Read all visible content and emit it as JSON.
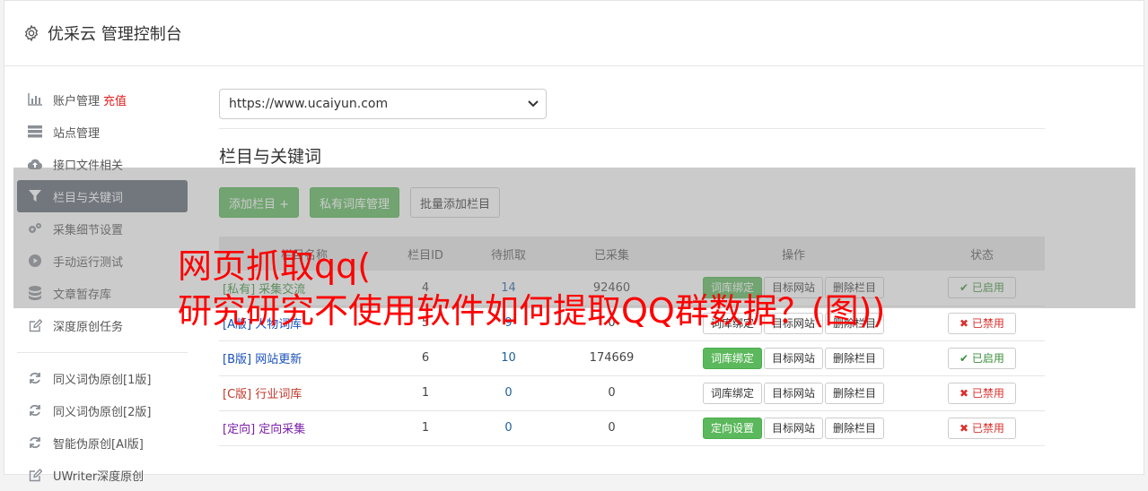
{
  "header": {
    "title": "优采云 管理控制台",
    "icon": "gear-icon"
  },
  "sidebar": {
    "items": [
      {
        "label": "账户管理",
        "badge": "充值",
        "icon": "bar-chart-icon"
      },
      {
        "label": "站点管理",
        "icon": "server-icon"
      },
      {
        "label": "接口文件相关",
        "icon": "cloud-upload-icon"
      },
      {
        "label": "栏目与关键词",
        "icon": "filter-icon",
        "active": true
      },
      {
        "label": "采集细节设置",
        "icon": "cogs-icon"
      },
      {
        "label": "手动运行测试",
        "icon": "play-circle-icon"
      },
      {
        "label": "文章暂存库",
        "icon": "database-icon"
      },
      {
        "label": "深度原创任务",
        "icon": "edit-icon"
      }
    ],
    "items2": [
      {
        "label": "同义词伪原创[1版]",
        "icon": "refresh-icon"
      },
      {
        "label": "同义词伪原创[2版]",
        "icon": "refresh-icon"
      },
      {
        "label": "智能伪原创[AI版]",
        "icon": "refresh-icon"
      },
      {
        "label": "UWriter深度原创",
        "icon": "edit-icon"
      }
    ]
  },
  "main": {
    "site_select": "https://www.ucaiyun.com",
    "section_title": "栏目与关键词",
    "buttons": {
      "add": "添加栏目 +",
      "private": "私有词库管理",
      "batch": "批量添加栏目"
    },
    "table": {
      "headers": [
        "栏目名称",
        "栏目ID",
        "待抓取",
        "已采集",
        "操作",
        "状态"
      ],
      "rows": [
        {
          "tag": "[私有]",
          "name": "采集交流",
          "id": "4",
          "pending": "14",
          "collected": "92460",
          "op1": "词库绑定",
          "op2": "目标网站",
          "op3": "删除栏目",
          "status": "已启用",
          "cls": "green",
          "op1style": "green",
          "on": true
        },
        {
          "tag": "[A版]",
          "name": "人物词库",
          "id": "5",
          "pending": "9",
          "collected": "0",
          "op1": "词库绑定",
          "op2": "目标网站",
          "op3": "删除栏目",
          "status": "已禁用",
          "cls": "blue",
          "op1style": "white",
          "on": false
        },
        {
          "tag": "[B版]",
          "name": "网站更新",
          "id": "6",
          "pending": "10",
          "collected": "174669",
          "op1": "词库绑定",
          "op2": "目标网站",
          "op3": "删除栏目",
          "status": "已启用",
          "cls": "blue",
          "op1style": "green",
          "on": true
        },
        {
          "tag": "[C版]",
          "name": "行业词库",
          "id": "1",
          "pending": "0",
          "collected": "0",
          "op1": "词库绑定",
          "op2": "目标网站",
          "op3": "删除栏目",
          "status": "已禁用",
          "cls": "red",
          "op1style": "white",
          "on": false
        },
        {
          "tag": "[定向]",
          "name": "定向采集",
          "id": "1",
          "pending": "0",
          "collected": "0",
          "op1": "定向设置",
          "op2": "目标网站",
          "op3": "删除栏目",
          "status": "已禁用",
          "cls": "purple",
          "op1style": "green",
          "on": false
        }
      ]
    }
  },
  "overlay": {
    "line1": "网页抓取qq(",
    "line2": "研究研究不使用软件如何提取QQ群数据？(图))"
  }
}
